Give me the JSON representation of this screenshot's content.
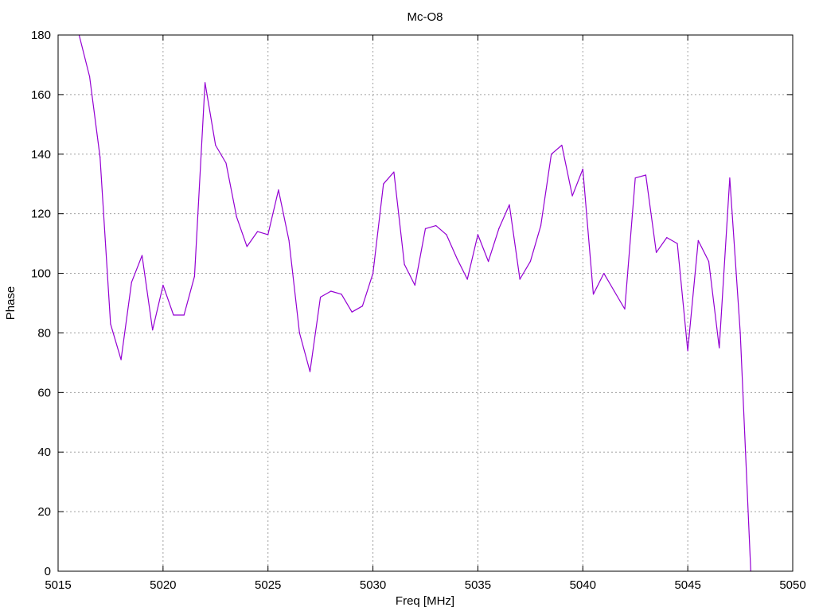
{
  "chart_data": {
    "type": "line",
    "title": "Mc-O8",
    "xlabel": "Freq [MHz]",
    "ylabel": "Phase",
    "xlim": [
      5015,
      5050
    ],
    "ylim": [
      0,
      180
    ],
    "x_ticks": [
      5015,
      5020,
      5025,
      5030,
      5035,
      5040,
      5045,
      5050
    ],
    "y_ticks": [
      0,
      20,
      40,
      60,
      80,
      100,
      120,
      140,
      160,
      180
    ],
    "grid": true,
    "series_color": "#9400d3",
    "series": [
      {
        "x": [
          5016,
          5016.5,
          5017,
          5017.5,
          5018,
          5018.5,
          5019,
          5019.5,
          5020,
          5020.5,
          5021,
          5021.5,
          5022,
          5022.5,
          5023,
          5023.5,
          5024,
          5024.5,
          5025,
          5025.5,
          5026,
          5026.5,
          5027,
          5027.5,
          5028,
          5028.5,
          5029,
          5029.5,
          5030,
          5030.5,
          5031,
          5031.5,
          5032,
          5032.5,
          5033,
          5033.5,
          5034,
          5034.5,
          5035,
          5035.5,
          5036,
          5036.5,
          5037,
          5037.5,
          5038,
          5038.5,
          5039,
          5039.5,
          5040,
          5040.5,
          5041,
          5041.5,
          5042,
          5042.5,
          5043,
          5043.5,
          5044,
          5044.5,
          5045,
          5045.5,
          5046,
          5046.5,
          5047,
          5047.5,
          5048
        ],
        "y": [
          180,
          166,
          139,
          83,
          71,
          97,
          106,
          81,
          96,
          86,
          86,
          99,
          164,
          143,
          137,
          119,
          109,
          114,
          113,
          128,
          111,
          80,
          67,
          92,
          94,
          93,
          87,
          89,
          100,
          130,
          134,
          103,
          96,
          115,
          116,
          113,
          105,
          98,
          113,
          104,
          115,
          123,
          98,
          104,
          116,
          140,
          143,
          126,
          135,
          93,
          100,
          94,
          88,
          132,
          133,
          107,
          112,
          110,
          74,
          111,
          104,
          75,
          132,
          80,
          0
        ]
      }
    ]
  }
}
